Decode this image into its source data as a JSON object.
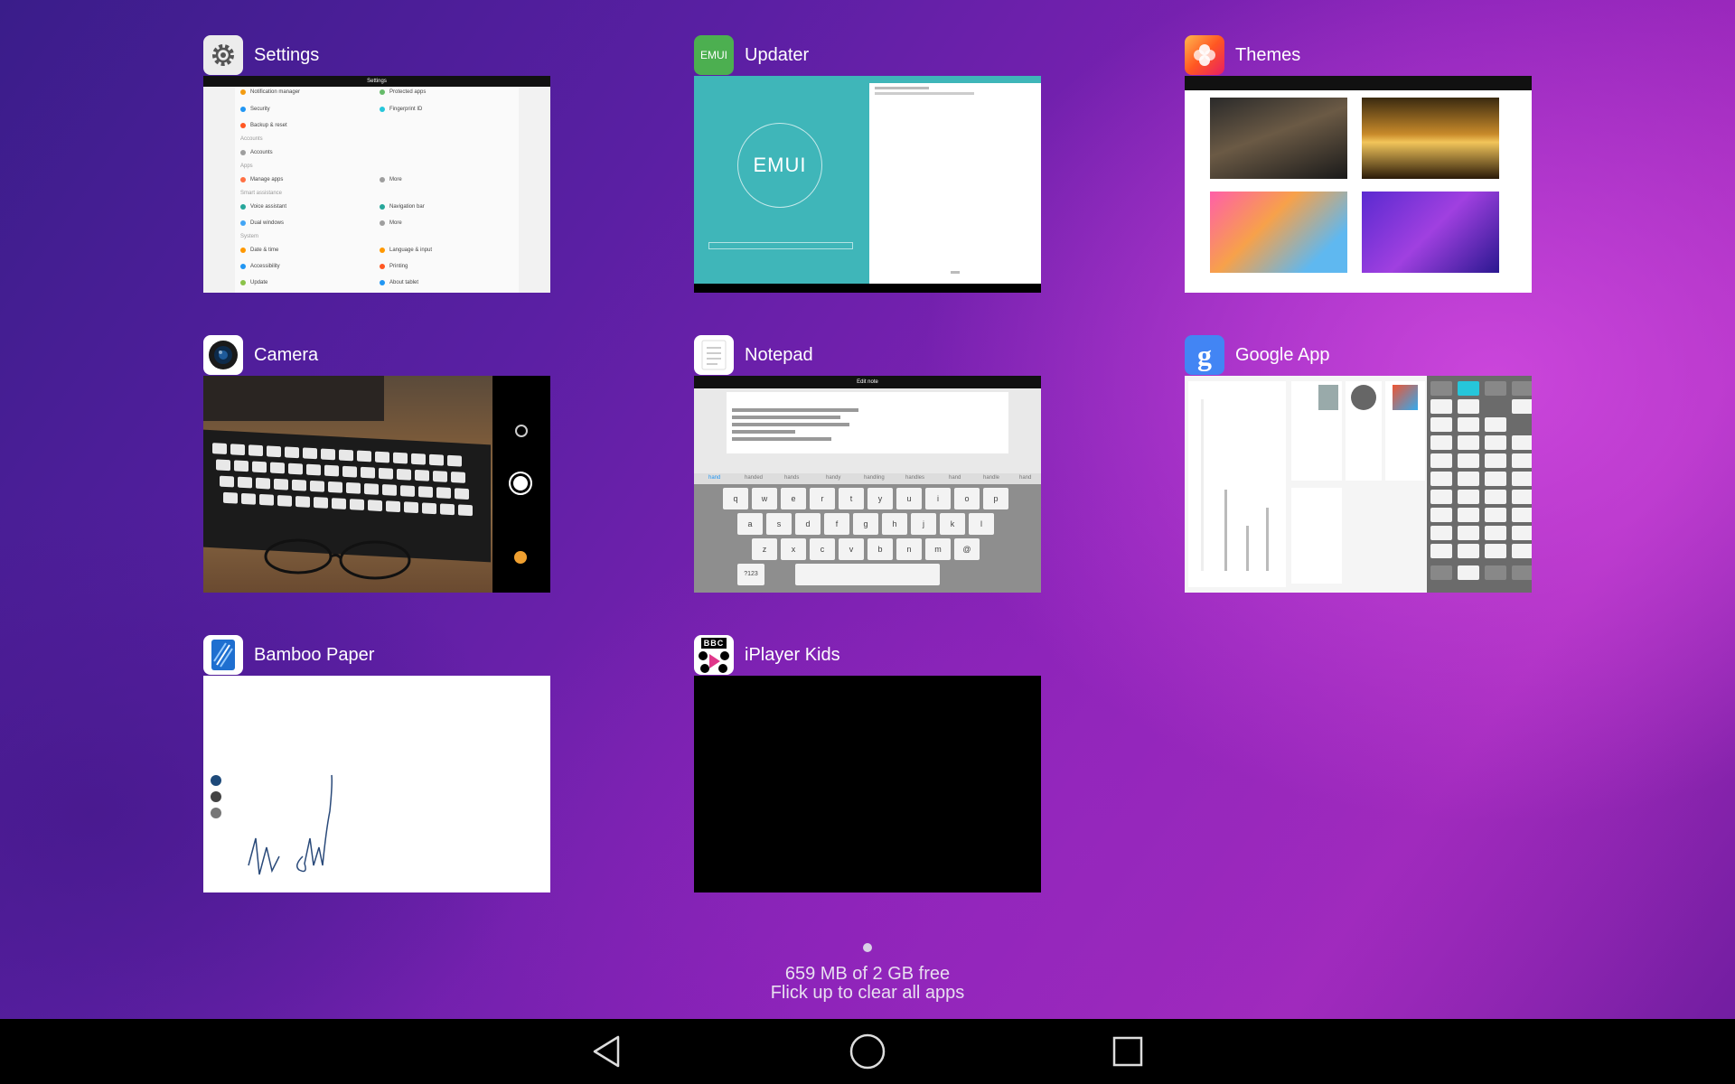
{
  "apps": [
    {
      "title": "Settings",
      "icon": "settings-gear-icon"
    },
    {
      "title": "Updater",
      "icon_text": "EMUI",
      "thumb_logo": "EMUI"
    },
    {
      "title": "Themes",
      "icon": "themes-flower-icon"
    },
    {
      "title": "Camera",
      "icon": "camera-lens-icon"
    },
    {
      "title": "Notepad",
      "icon": "notepad-icon"
    },
    {
      "title": "Google App",
      "icon_text": "g"
    },
    {
      "title": "Bamboo Paper",
      "icon": "bamboo-paper-icon"
    },
    {
      "title": "iPlayer Kids",
      "icon_text": "BBC"
    }
  ],
  "settings_thumb": {
    "title": "Settings",
    "left_items": [
      "Notification manager",
      "Security",
      "Backup & reset",
      "Accounts",
      "Manage apps",
      "Voice assistant",
      "Dual windows",
      "Date & time",
      "Accessibility",
      "Update"
    ],
    "right_items": [
      "Protected apps",
      "Fingerprint ID",
      "More",
      "Navigation bar",
      "More",
      "Language & input",
      "Printing",
      "About tablet"
    ],
    "sections": [
      "Accounts",
      "Apps",
      "Smart assistance",
      "System"
    ]
  },
  "notepad_thumb": {
    "title": "Edit note",
    "suggestions": [
      "hand",
      "handed",
      "hands",
      "handy",
      "handling",
      "handles",
      "hand",
      "handle",
      "hand"
    ],
    "row1": [
      "q",
      "w",
      "e",
      "r",
      "t",
      "y",
      "u",
      "i",
      "o",
      "p"
    ],
    "row2": [
      "a",
      "s",
      "d",
      "f",
      "g",
      "h",
      "j",
      "k",
      "l"
    ],
    "row3": [
      "z",
      "x",
      "c",
      "v",
      "b",
      "n",
      "m",
      "@"
    ],
    "num_key": "?123"
  },
  "footer": {
    "memory": "659 MB of 2 GB free",
    "hint": "Flick up to clear all apps"
  },
  "colors": {
    "settings_icon": "#ececec",
    "updater_icon": "#4caf50",
    "themes_icon": "#ff7043",
    "camera_icon": "#ffffff",
    "notepad_icon": "#ffffff",
    "google_icon": "#4285f4",
    "bamboo_icon": "#ffffff",
    "iplayer_icon": "#ffffff"
  }
}
